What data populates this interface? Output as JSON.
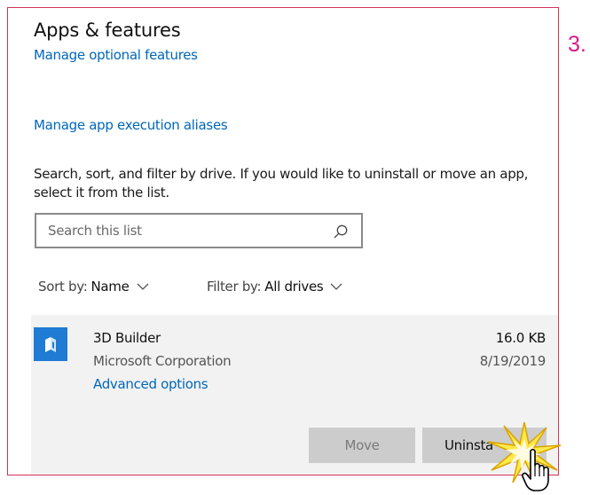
{
  "window": {
    "title": "Apps & features"
  },
  "links": {
    "optional_features": "Manage optional features",
    "execution_aliases": "Manage app execution aliases"
  },
  "description": "Search, sort, and filter by drive. If you would like to uninstall or move an app, select it from the list.",
  "search": {
    "placeholder": "Search this list",
    "value": ""
  },
  "sort": {
    "label": "Sort by:",
    "value": "Name"
  },
  "filter": {
    "label": "Filter by:",
    "value": "All drives"
  },
  "selected_app": {
    "name": "3D Builder",
    "publisher": "Microsoft Corporation",
    "advanced_options_label": "Advanced options",
    "size": "16.0 KB",
    "install_date": "8/19/2019",
    "icon": "3d-builder-icon"
  },
  "buttons": {
    "move_label": "Move",
    "uninstall_label": "Uninsta"
  },
  "annotation": {
    "step_number": "3."
  },
  "colors": {
    "frame_border": "#d8315b",
    "link": "#0067b8",
    "step_marker": "#d81b8a",
    "app_icon": "#1f7bd3",
    "selected_panel": "#f2f2f2",
    "button": "#cccccc"
  }
}
